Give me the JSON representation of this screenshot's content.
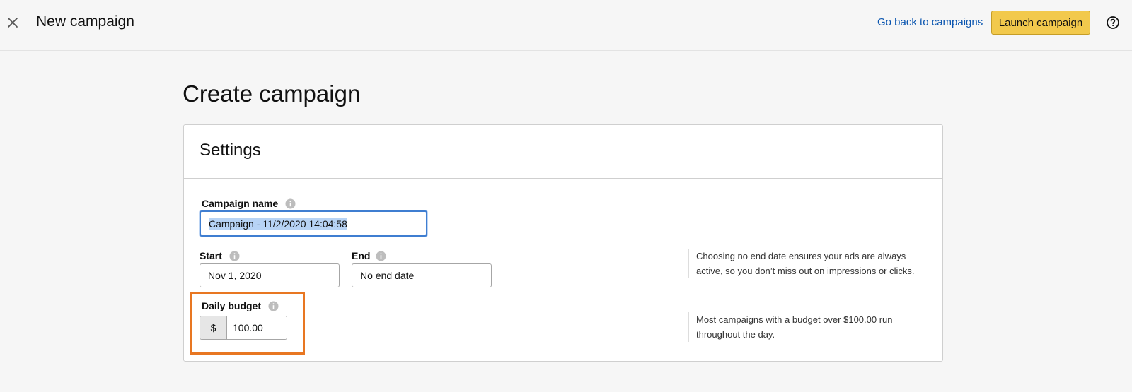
{
  "header": {
    "title": "New campaign",
    "back_link": "Go back to campaigns",
    "launch_label": "Launch campaign"
  },
  "page": {
    "heading": "Create campaign"
  },
  "settings": {
    "title": "Settings",
    "campaign_name_label": "Campaign name",
    "campaign_name_value": "Campaign - 11/2/2020 14:04:58",
    "start_label": "Start",
    "start_value": "Nov 1, 2020",
    "end_label": "End",
    "end_value": "No end date",
    "end_hint": "Choosing no end date ensures your ads are always active, so you don’t miss out on impressions or clicks.",
    "budget_label": "Daily budget",
    "budget_currency": "$",
    "budget_value": "100.00",
    "budget_hint": "Most campaigns with a budget over $100.00 run throughout the day."
  },
  "colors": {
    "accent_button": "#f2c94c",
    "link": "#0b56b0",
    "highlight": "#e87722",
    "focus": "#3f7ed1"
  }
}
